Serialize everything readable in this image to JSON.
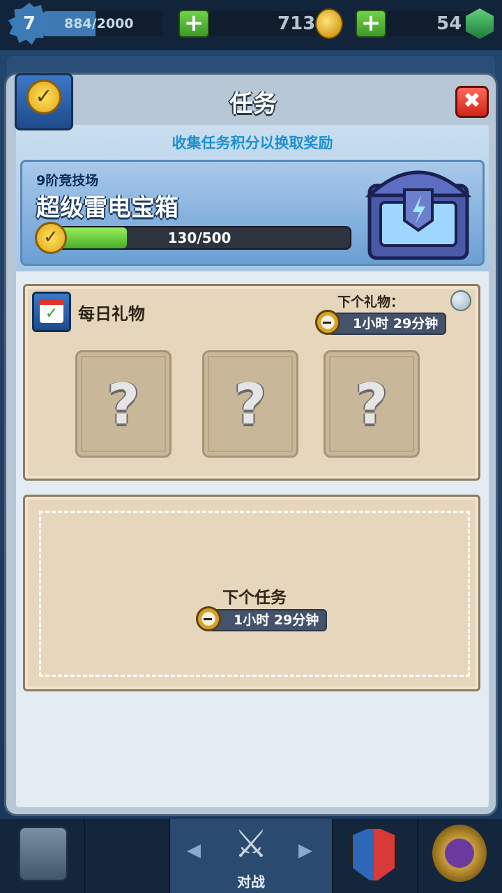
{
  "topbar": {
    "level": "7",
    "xp": "884/2000",
    "xp_fraction": 0.442,
    "gold": "713",
    "gems": "54",
    "plus_symbol": "+"
  },
  "modal": {
    "title": "任务",
    "close_symbol": "✖",
    "subtitle": "收集任务积分以换取奖励"
  },
  "chest": {
    "arena": "9阶竞技场",
    "name": "超级雷电宝箱",
    "progress_text": "130/500",
    "progress_fraction": 0.26
  },
  "daily": {
    "title": "每日礼物",
    "next_gift_label": "下个礼物：",
    "timer": "1小时 29分钟",
    "slots": [
      "?",
      "?",
      "?"
    ]
  },
  "next_task": {
    "label": "下个任务",
    "timer": "1小时 29分钟"
  },
  "nav": {
    "battle_label": "对战",
    "left_arrow": "◀",
    "right_arrow": "▶"
  },
  "colors": {
    "accent_blue": "#1c8fd1",
    "progress_green": "#4aad2a",
    "close_red": "#d0241a",
    "paper": "#e6d6bc"
  },
  "icons": [
    "level-badge-icon",
    "gold-coin-icon",
    "gem-icon",
    "quest-book-icon",
    "close-icon",
    "medal-icon",
    "calendar-icon",
    "timer-icon",
    "pin-icon",
    "chest-icon",
    "cards-icon",
    "battle-swords-icon",
    "clan-icon",
    "tournament-icon"
  ]
}
